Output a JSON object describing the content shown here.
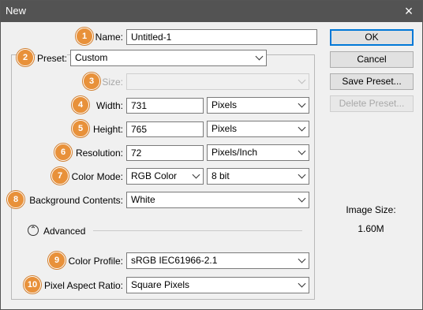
{
  "window": {
    "title": "New"
  },
  "fields": {
    "name": {
      "badge": "1",
      "label": "Name:",
      "value": "Untitled-1"
    },
    "preset": {
      "badge": "2",
      "label": "Preset:",
      "value": "Custom"
    },
    "size": {
      "badge": "3",
      "label": "Size:",
      "value": ""
    },
    "width": {
      "badge": "4",
      "label": "Width:",
      "value": "731",
      "unit": "Pixels"
    },
    "height": {
      "badge": "5",
      "label": "Height:",
      "value": "765",
      "unit": "Pixels"
    },
    "resolution": {
      "badge": "6",
      "label": "Resolution:",
      "value": "72",
      "unit": "Pixels/Inch"
    },
    "color_mode": {
      "badge": "7",
      "label": "Color Mode:",
      "value": "RGB Color",
      "depth": "8 bit"
    },
    "background": {
      "badge": "8",
      "label": "Background Contents:",
      "value": "White"
    },
    "color_profile": {
      "badge": "9",
      "label": "Color Profile:",
      "value": "sRGB IEC61966-2.1"
    },
    "pixel_aspect": {
      "badge": "10",
      "label": "Pixel Aspect Ratio:",
      "value": "Square Pixels"
    }
  },
  "advanced": {
    "toggle_glyph": "⌃",
    "label": "Advanced"
  },
  "buttons": {
    "ok": "OK",
    "cancel": "Cancel",
    "save_preset": "Save Preset...",
    "delete_preset": "Delete Preset..."
  },
  "image_size": {
    "label": "Image Size:",
    "value": "1.60M"
  },
  "icons": {
    "close": "×",
    "dropdown": "chevron-down-icon"
  }
}
